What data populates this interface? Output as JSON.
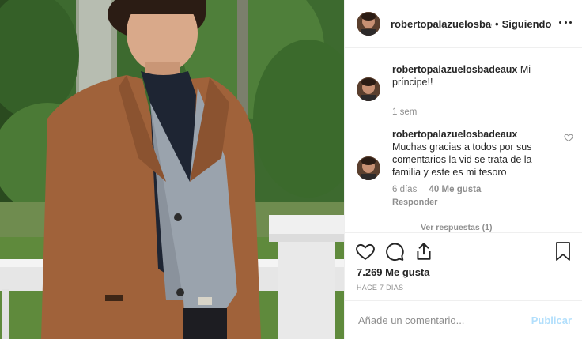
{
  "post": {
    "image_alt": "Young man in a camel overcoat standing on a porch",
    "author": "robertopalazuelosbade",
    "follow_separator": "•",
    "follow_label": "Siguiendo",
    "more_icon": "more-horizontal-icon"
  },
  "comments": [
    {
      "user": "robertopalazuelosbadeaux",
      "text": "Mi príncipe!!",
      "time": "1 sem"
    },
    {
      "user": "robertopalazuelosbadeaux",
      "text": "Muchas gracias a todos por sus comentarios la vid se trata de la familia y este es mi tesoro",
      "time": "6 días",
      "likes": "40 Me gusta",
      "reply_label": "Responder",
      "view_replies": "Ver respuestas (1)"
    }
  ],
  "actions": {
    "like_icon": "heart-icon",
    "comment_icon": "comment-icon",
    "share_icon": "share-icon",
    "save_icon": "bookmark-icon",
    "likes_count": "7.269 Me gusta",
    "posted_time": "HACE 7 DÍAS"
  },
  "add_comment": {
    "placeholder": "Añade un comentario...",
    "publish_label": "Publicar"
  },
  "colors": {
    "publish_disabled": "#b2dffc",
    "muted_text": "#8e8e8e",
    "text": "#262626",
    "coat": "#a0623a"
  }
}
